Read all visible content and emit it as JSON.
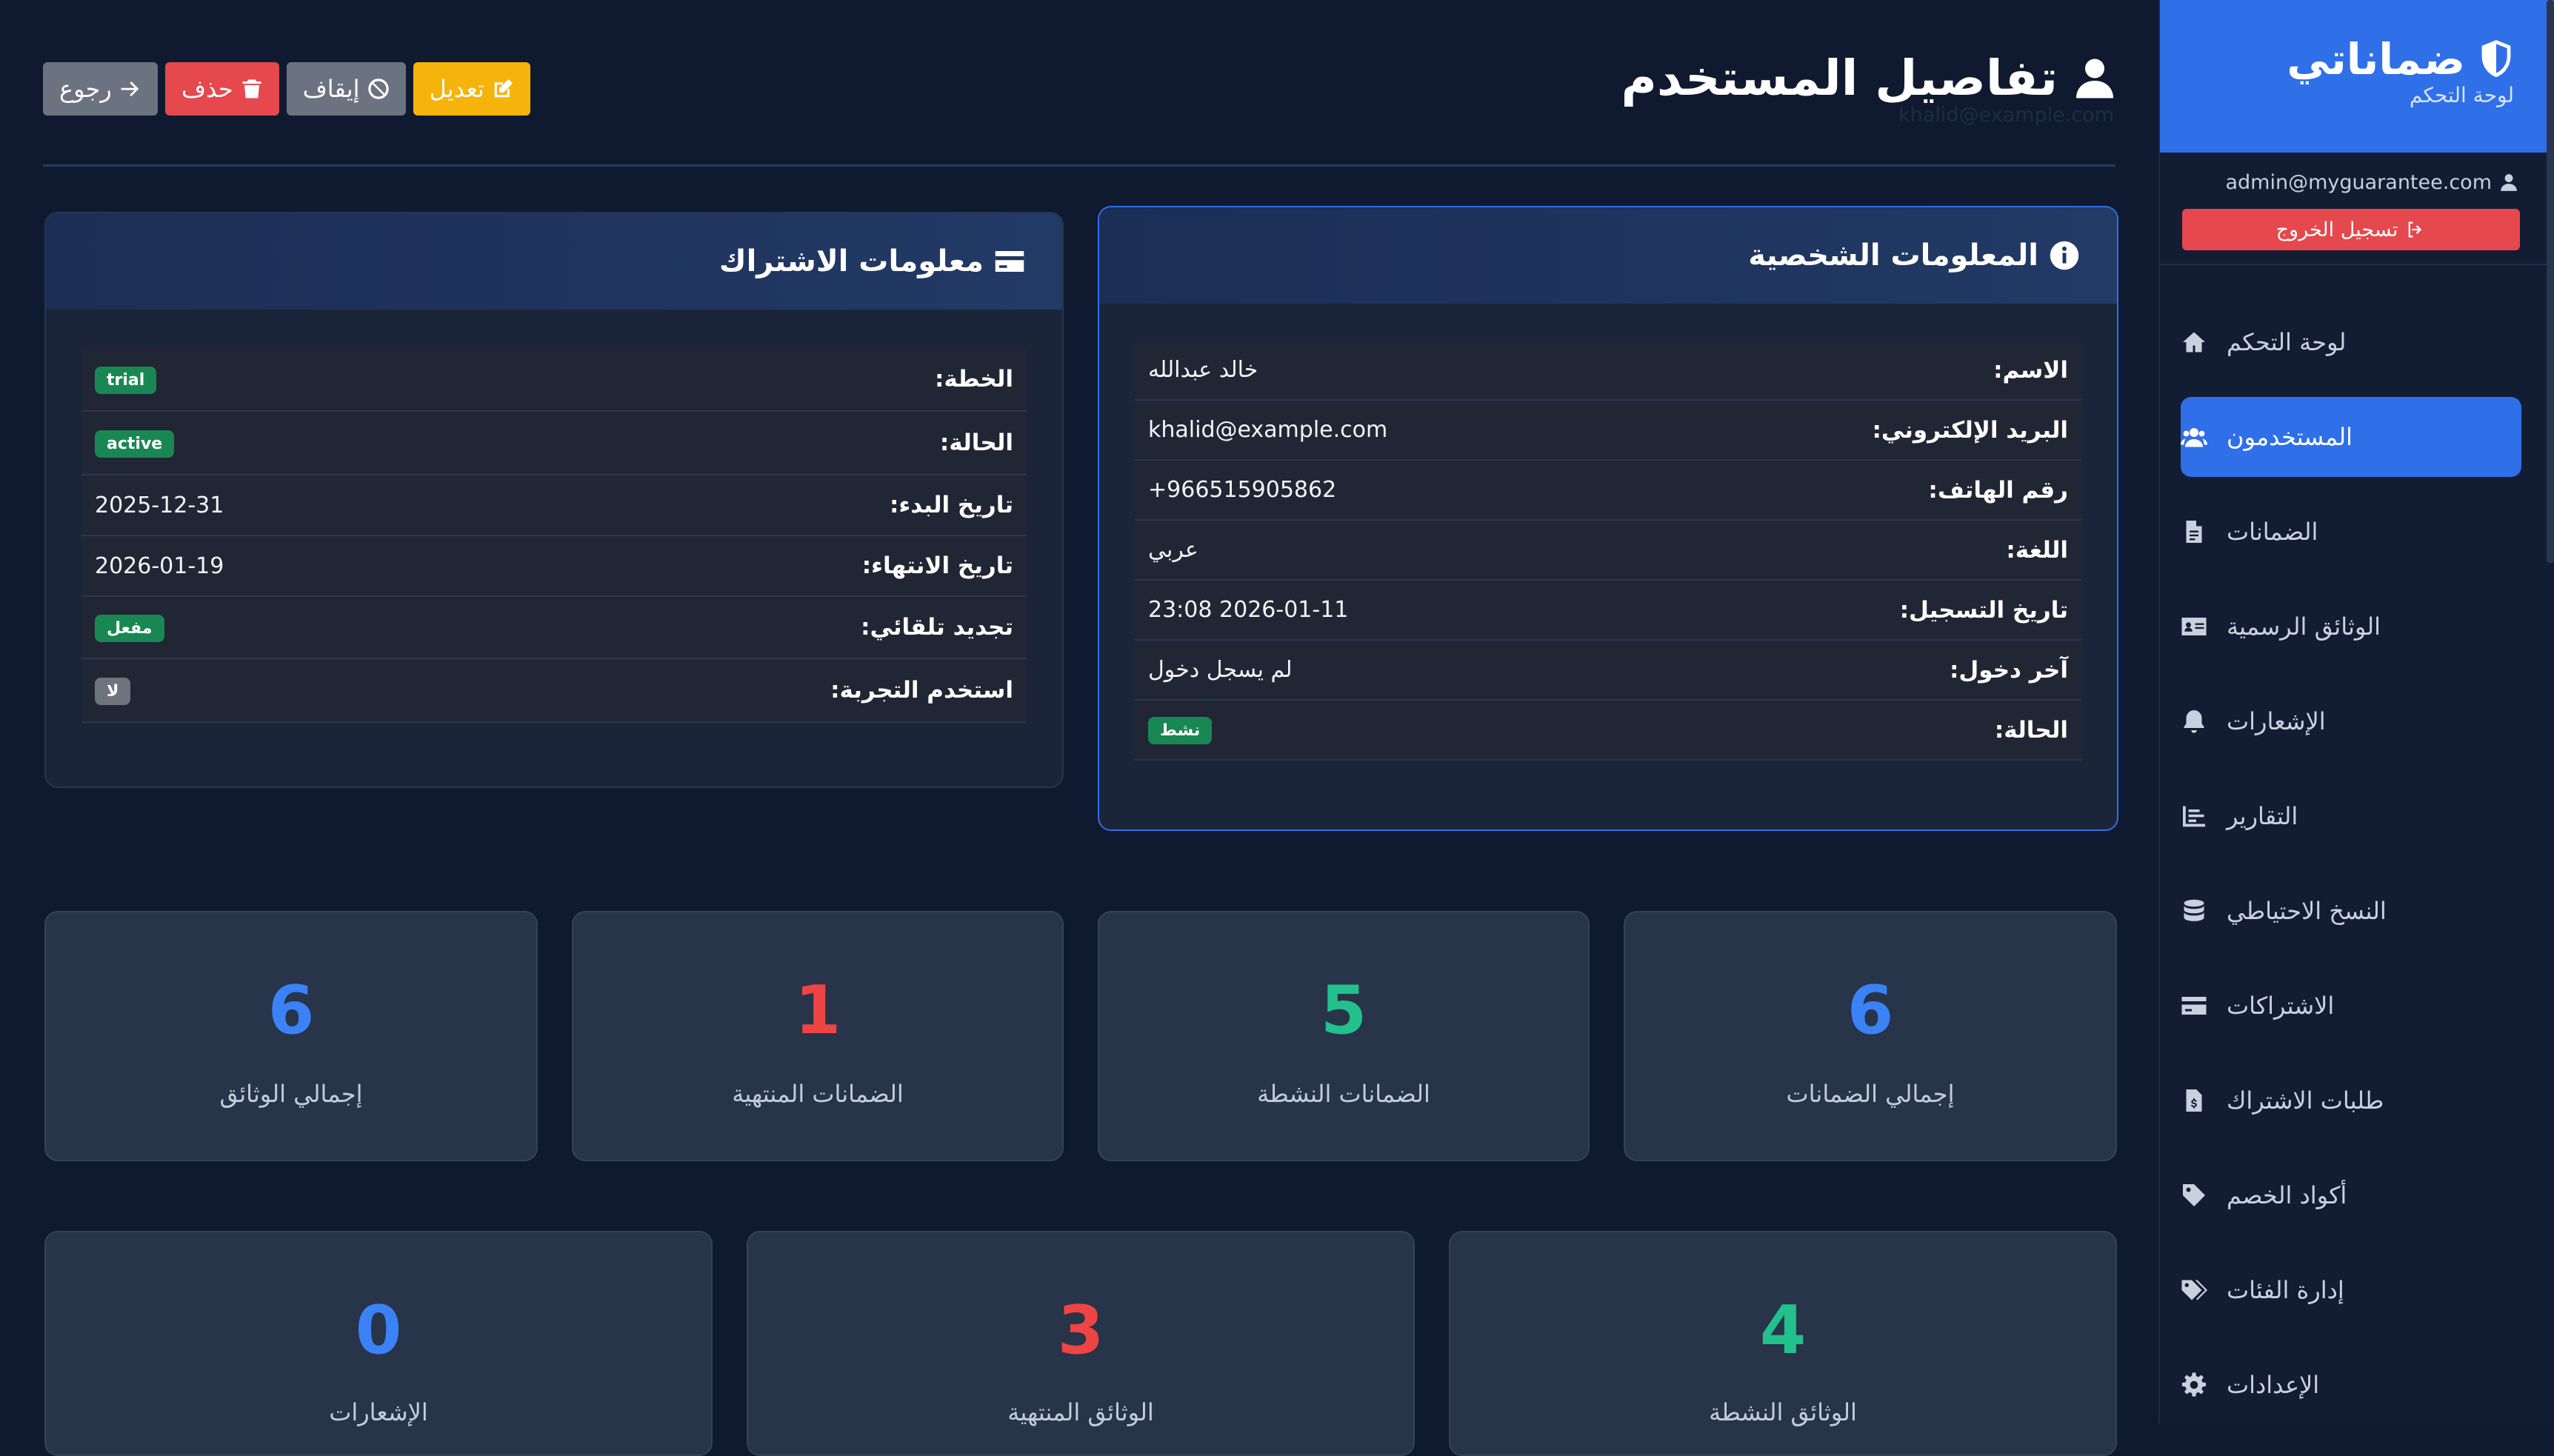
{
  "brand": {
    "title": "ضماناتي",
    "subtitle": "لوحة التحكم"
  },
  "sidebar": {
    "user_email": "admin@myguarantee.com",
    "logout_label": "تسجيل الخروج",
    "items": [
      {
        "label": "لوحة التحكم",
        "icon": "home-icon"
      },
      {
        "label": "المستخدمون",
        "icon": "users-icon",
        "active": true
      },
      {
        "label": "الضمانات",
        "icon": "file-icon"
      },
      {
        "label": "الوثائق الرسمية",
        "icon": "id-card-icon"
      },
      {
        "label": "الإشعارات",
        "icon": "bell-icon"
      },
      {
        "label": "التقارير",
        "icon": "chart-icon"
      },
      {
        "label": "النسخ الاحتياطي",
        "icon": "database-icon"
      },
      {
        "label": "الاشتراكات",
        "icon": "credit-card-icon"
      },
      {
        "label": "طلبات الاشتراك",
        "icon": "invoice-icon"
      },
      {
        "label": "أكواد الخصم",
        "icon": "tag-icon"
      },
      {
        "label": "إدارة الفئات",
        "icon": "tags-icon"
      },
      {
        "label": "الإعدادات",
        "icon": "gear-icon"
      }
    ]
  },
  "header": {
    "title": "تفاصيل المستخدم",
    "subtitle": "khalid@example.com",
    "actions": {
      "edit": "تعديل",
      "suspend": "إيقاف",
      "delete": "حذف",
      "back": "رجوع"
    }
  },
  "personal": {
    "title": "المعلومات الشخصية",
    "rows": [
      {
        "label": "الاسم:",
        "value": "خالد عبدالله"
      },
      {
        "label": "البريد الإلكتروني:",
        "value": "khalid@example.com"
      },
      {
        "label": "رقم الهاتف:",
        "value": "966515905862+"
      },
      {
        "label": "اللغة:",
        "value": "عربي"
      },
      {
        "label": "تاريخ التسجيل:",
        "value": "2026-01-11 23:08"
      },
      {
        "label": "آخر دخول:",
        "value": "لم يسجل دخول"
      },
      {
        "label": "الحالة:",
        "value": "نشط"
      }
    ]
  },
  "subscription": {
    "title": "معلومات الاشتراك",
    "rows": [
      {
        "label": "الخطة:",
        "value": "trial"
      },
      {
        "label": "الحالة:",
        "value": "active"
      },
      {
        "label": "تاريخ البدء:",
        "value": "2025-12-31"
      },
      {
        "label": "تاريخ الانتهاء:",
        "value": "2026-01-19"
      },
      {
        "label": "تجديد تلقائي:",
        "value": "مفعل"
      },
      {
        "label": "استخدم التجربة:",
        "value": "لا"
      }
    ]
  },
  "stats_row1": [
    {
      "value": "6",
      "label": "إجمالي الضمانات",
      "color": "#3b82f6"
    },
    {
      "value": "5",
      "label": "الضمانات النشطة",
      "color": "#22c08a"
    },
    {
      "value": "1",
      "label": "الضمانات المنتهية",
      "color": "#ef4444"
    },
    {
      "value": "6",
      "label": "إجمالي الوثائق",
      "color": "#3b82f6"
    }
  ],
  "stats_row2": [
    {
      "value": "4",
      "label": "الوثائق النشطة",
      "color": "#22c08a"
    },
    {
      "value": "3",
      "label": "الوثائق المنتهية",
      "color": "#ef4444"
    },
    {
      "value": "0",
      "label": "الإشعارات",
      "color": "#3b82f6"
    }
  ]
}
